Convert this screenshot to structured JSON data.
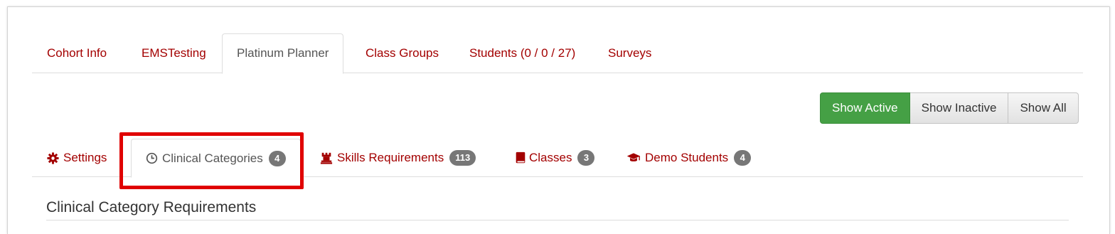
{
  "top_tabs": [
    {
      "label": "Cohort Info"
    },
    {
      "label": "EMSTesting"
    },
    {
      "label": "Platinum Planner"
    },
    {
      "label": "Class Groups"
    },
    {
      "label": "Students (0 / 0 / 27)"
    },
    {
      "label": "Surveys"
    }
  ],
  "filter_buttons": {
    "active": "Show Active",
    "inactive": "Show Inactive",
    "all": "Show All"
  },
  "sub_tabs": [
    {
      "label": "Settings",
      "icon": "gear-icon"
    },
    {
      "label": "Clinical Categories",
      "icon": "clock-icon",
      "badge": "4"
    },
    {
      "label": "Skills Requirements",
      "icon": "rook-icon",
      "badge": "113"
    },
    {
      "label": "Classes",
      "icon": "book-icon",
      "badge": "3"
    },
    {
      "label": "Demo Students",
      "icon": "graduation-cap-icon",
      "badge": "4"
    }
  ],
  "section": {
    "title": "Clinical Category Requirements"
  },
  "colors": {
    "link": "#a30000",
    "primary_button": "#45a045",
    "highlight": "#e00000",
    "badge": "#777777"
  }
}
